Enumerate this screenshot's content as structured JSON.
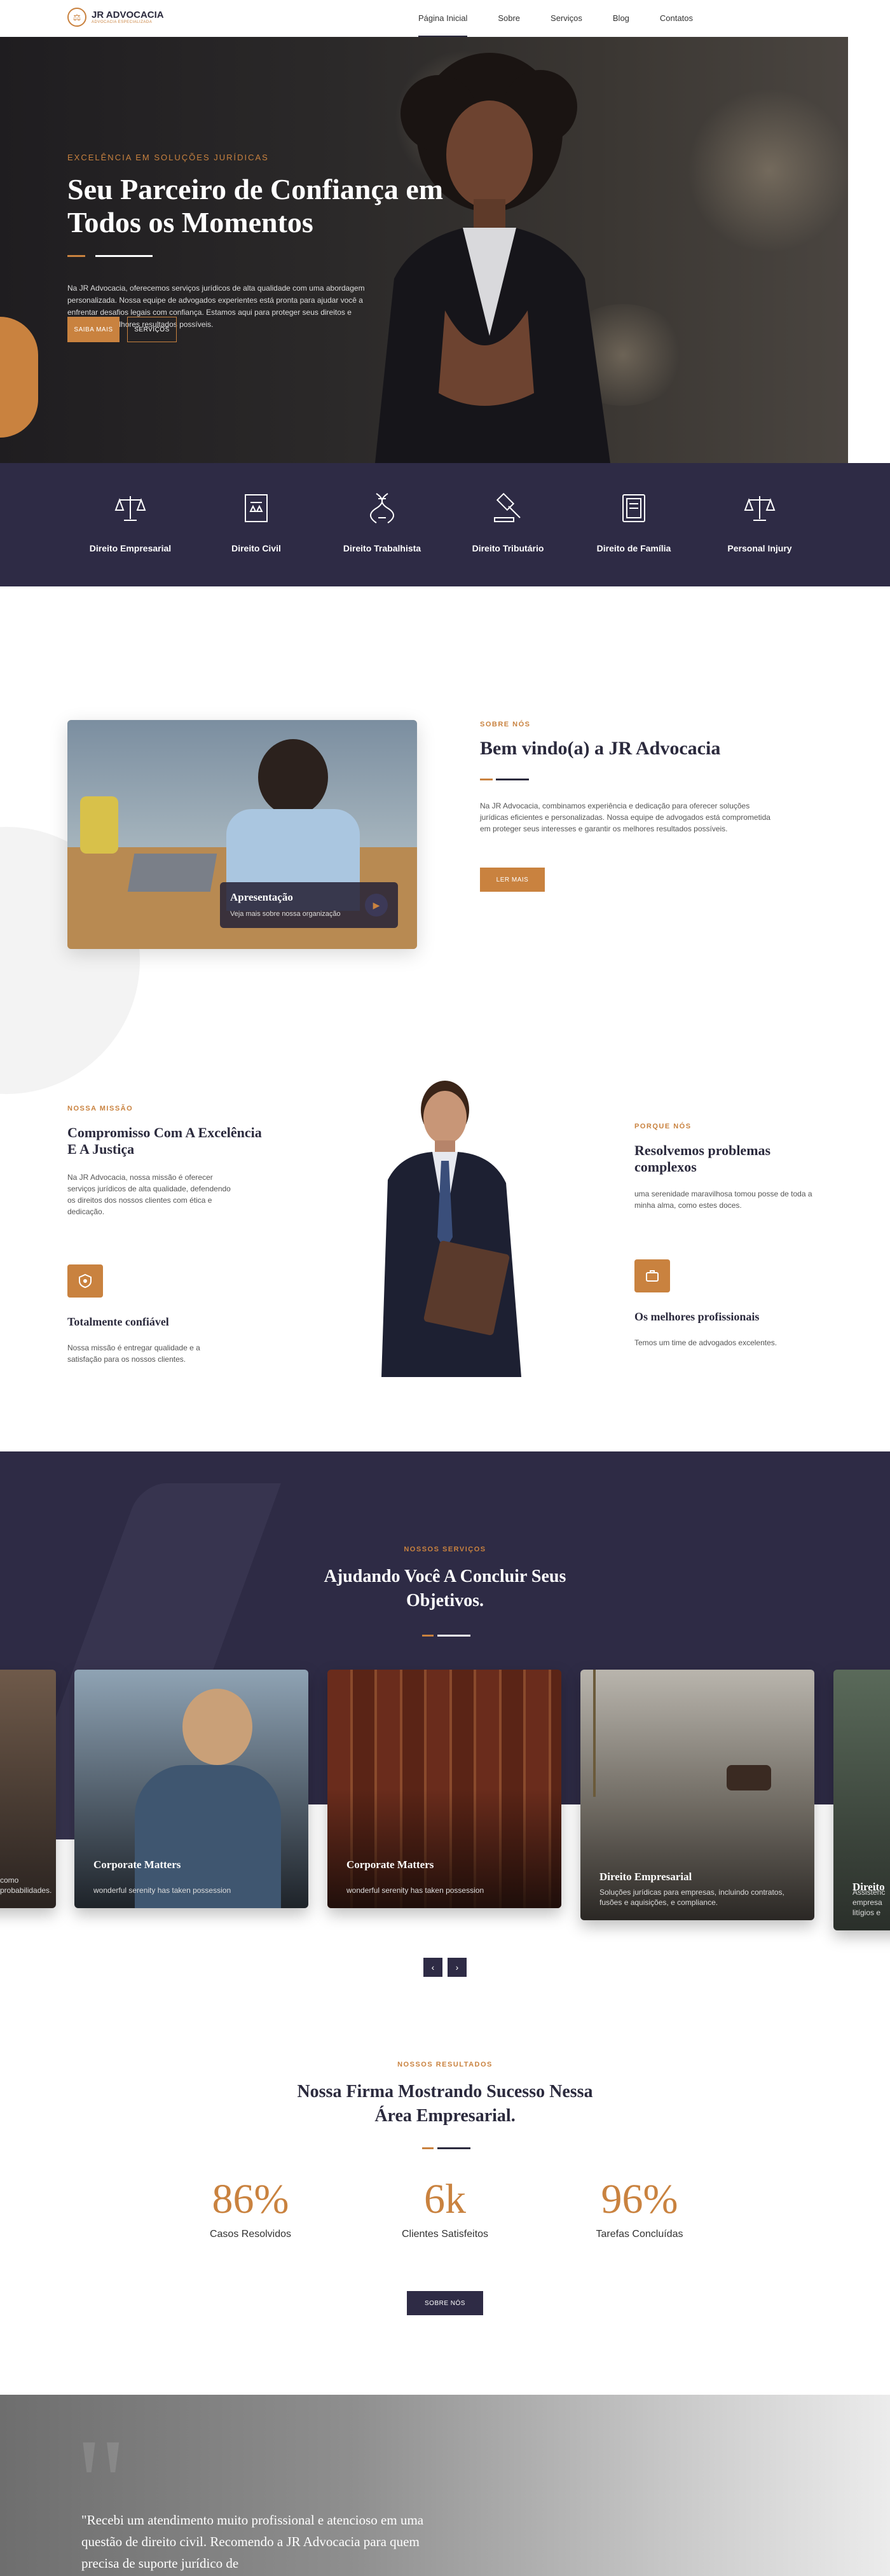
{
  "brand": {
    "name": "JR ADVOCACIA",
    "tagline": "ADVOCACIA ESPECIALIZADA"
  },
  "nav": {
    "items": [
      "Página Inicial",
      "Sobre",
      "Serviços",
      "Blog",
      "Contatos"
    ]
  },
  "hero": {
    "kicker": "EXCELÊNCIA EM SOLUÇÕES JURÍDICAS",
    "title": "Seu Parceiro de Confiança em Todos os Momentos",
    "text": "Na JR Advocacia, oferecemos serviços jurídicos de alta qualidade com uma abordagem personalizada. Nossa equipe de advogados experientes está pronta para ajudar você a enfrentar desafios legais com confiança. Estamos aqui para proteger seus direitos e alcançar os melhores resultados possíveis.",
    "btn_primary": "SAIBA MAIS",
    "btn_secondary": "SERVIÇOS"
  },
  "areas": [
    {
      "label": "Direito Empresarial",
      "icon": "scales-icon"
    },
    {
      "label": "Direito Civil",
      "icon": "law-book-icon"
    },
    {
      "label": "Direito Trabalhista",
      "icon": "dna-icon"
    },
    {
      "label": "Direito Tributário",
      "icon": "gavel-icon"
    },
    {
      "label": "Direito de Família",
      "icon": "document-icon"
    },
    {
      "label": "Personal Injury",
      "icon": "scales-icon"
    }
  ],
  "about": {
    "kicker": "SOBRE NÓS",
    "title": "Bem vindo(a) a JR Advocacia",
    "text": "Na JR Advocacia, combinamos experiência e dedicação para oferecer soluções jurídicas eficientes e personalizadas. Nossa equipe de advogados está comprometida em proteger seus interesses e garantir os melhores resultados possíveis.",
    "button": "LER MAIS",
    "video_title": "Apresentação",
    "video_sub": "Veja mais sobre nossa organização"
  },
  "mission": {
    "kicker": "NOSSA MISSÃO",
    "title": "Compromisso Com A Excelência E A Justiça",
    "text": "Na JR Advocacia, nossa missão é oferecer serviços jurídicos de alta qualidade, defendendo os direitos dos nossos clientes com ética e dedicação.",
    "feature1_title": "Totalmente confiável",
    "feature1_text": "Nossa missão é entregar qualidade e a satisfação para os nossos clientes.",
    "right_kicker": "PORQUE NÓS",
    "right_title": "Resolvemos problemas complexos",
    "right_text": "uma serenidade maravilhosa tomou posse de toda a minha alma, como estes doces.",
    "feature2_title": "Os melhores profissionais",
    "feature2_text": "Temos um time de advogados excelentes."
  },
  "services": {
    "kicker": "NOSSOS SERVIÇOS",
    "title": "Ajudando Você A Concluir Seus Objetivos.",
    "cards": [
      {
        "title": "",
        "desc": "como\nprobabilidades."
      },
      {
        "title": "Corporate Matters",
        "desc": "wonderful serenity has taken possession"
      },
      {
        "title": "Corporate Matters",
        "desc": "wonderful serenity has taken possession"
      },
      {
        "title": "Direito Empresarial",
        "desc": "Soluções jurídicas para empresas, incluindo contratos, fusões e aquisições, e compliance."
      },
      {
        "title": "Direito",
        "desc": "Assistênc\nempresa\nlitígios e"
      }
    ],
    "prev": "‹",
    "next": "›"
  },
  "results": {
    "kicker": "NOSSOS RESULTADOS",
    "title": "Nossa Firma Mostrando Sucesso Nessa Área Empresarial.",
    "stats": [
      {
        "value": "86%",
        "label": "Casos Resolvidos"
      },
      {
        "value": "6k",
        "label": "Clientes Satisfeitos"
      },
      {
        "value": "96%",
        "label": "Tarefas Concluídas"
      }
    ],
    "button": "SOBRE NÓS"
  },
  "testimonial": {
    "quote": "\"Recebi um atendimento muito profissional e atencioso em uma questão de direito civil. Recomendo a JR Advocacia para quem precisa de suporte jurídico de"
  },
  "colors": {
    "accent": "#c9823f",
    "navy": "#2e2b45"
  }
}
